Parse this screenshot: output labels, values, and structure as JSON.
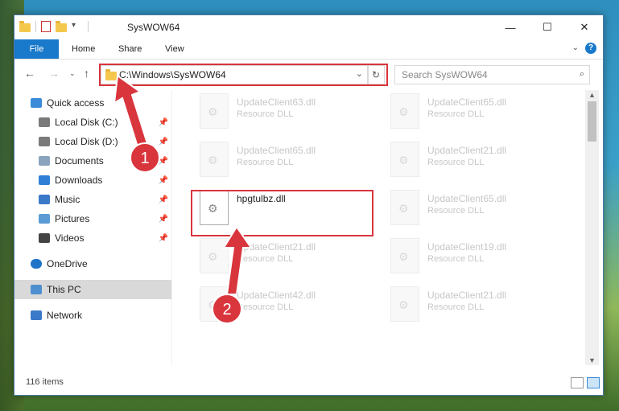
{
  "window": {
    "title": "SysWOW64"
  },
  "ribbon": {
    "tabs": [
      "File",
      "Home",
      "Share",
      "View"
    ],
    "help": "?"
  },
  "address": {
    "path": "C:\\Windows\\SysWOW64"
  },
  "search": {
    "placeholder": "Search SysWOW64"
  },
  "sidebar": {
    "items": [
      {
        "label": "Quick access"
      },
      {
        "label": "Local Disk (C:)"
      },
      {
        "label": "Local Disk (D:)"
      },
      {
        "label": "Documents"
      },
      {
        "label": "Downloads"
      },
      {
        "label": "Music"
      },
      {
        "label": "Pictures"
      },
      {
        "label": "Videos"
      },
      {
        "label": "OneDrive"
      },
      {
        "label": "This PC"
      },
      {
        "label": "Network"
      }
    ]
  },
  "files": [
    {
      "name": "UpdateClient63.dll",
      "type": "Resource DLL"
    },
    {
      "name": "UpdateClient65.dll",
      "type": "Resource DLL"
    },
    {
      "name": "UpdateClient65.dll",
      "type": "Resource DLL"
    },
    {
      "name": "UpdateClient21.dll",
      "type": "Resource DLL"
    },
    {
      "name": "hpgtulbz.dll",
      "type": ""
    },
    {
      "name": "UpdateClient65.dll",
      "type": "Resource DLL"
    },
    {
      "name": "UpdateClient21.dll",
      "type": "Resource DLL"
    },
    {
      "name": "UpdateClient19.dll",
      "type": "Resource DLL"
    },
    {
      "name": "UpdateClient42.dll",
      "type": "Resource DLL"
    },
    {
      "name": "UpdateClient21.dll",
      "type": "Resource DLL"
    }
  ],
  "status": {
    "item_count": "116 items"
  },
  "callouts": {
    "one": "1",
    "two": "2"
  },
  "colors": {
    "accent": "#1979ca",
    "highlight": "#d9353d"
  }
}
